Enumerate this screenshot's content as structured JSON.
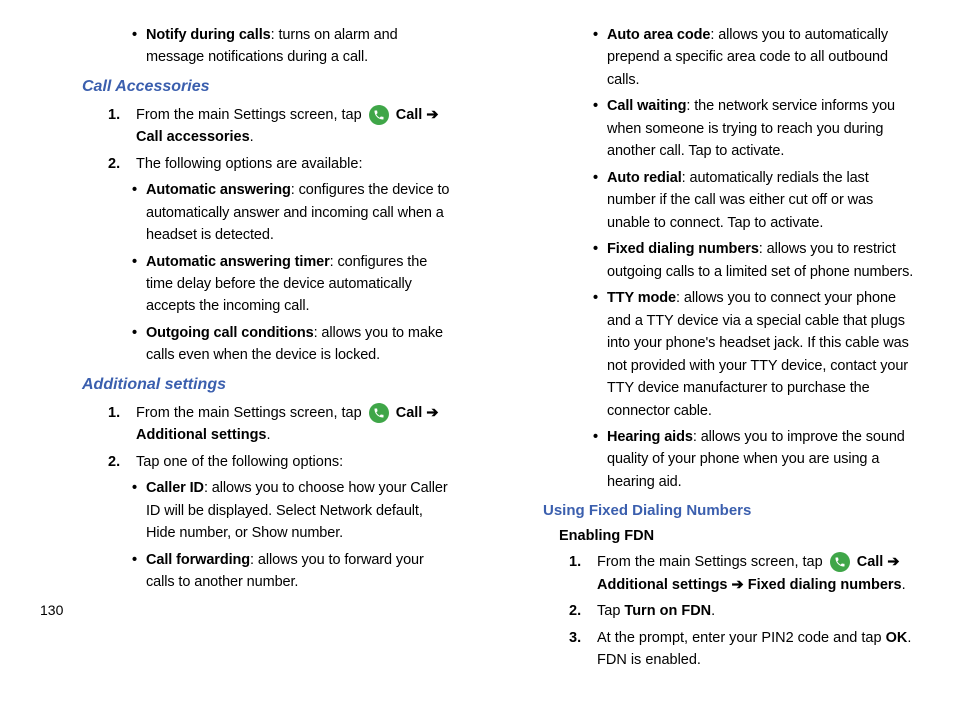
{
  "pagenum": "130",
  "left": {
    "notify_b": "Notify during calls",
    "notify_t": ": turns on alarm and message notifications during a call.",
    "h1": "Call Accessories",
    "l1_1a": "From the main Settings screen, tap ",
    "l1_1b": "Call ",
    "l1_1c": "Call accessories",
    "l1_2": "The following options are available:",
    "ca_b1_b": "Automatic answering",
    "ca_b1_t": ": configures the device to automatically answer and incoming call when a headset is detected.",
    "ca_b2_b": "Automatic answering timer",
    "ca_b2_t": ": configures the time delay before the device automatically accepts the incoming call.",
    "ca_b3_b": "Outgoing call conditions",
    "ca_b3_t": ": allows you to make calls even when the device is locked.",
    "h2": "Additional settings",
    "l2_1a": "From the main Settings screen, tap ",
    "l2_1b": "Call ",
    "l2_1c": "Additional settings",
    "l2_2": "Tap one of the following options:",
    "as_b1_b": "Caller ID",
    "as_b1_t": ": allows you to choose how your Caller ID will be displayed. Select Network default, Hide number, or Show number.",
    "as_b2_b": "Call forwarding",
    "as_b2_t": ": allows you to forward your calls to another number."
  },
  "right": {
    "r_b1_b": "Auto area code",
    "r_b1_t": ": allows you to automatically prepend a specific area code to all outbound calls.",
    "r_b2_b": "Call waiting",
    "r_b2_t": ": the network service informs you when someone is trying to reach you during another call. Tap to activate.",
    "r_b3_b": "Auto redial",
    "r_b3_t": ": automatically redials the last number if the call was either cut off or was unable to connect. Tap to activate.",
    "r_b4_b": "Fixed dialing numbers",
    "r_b4_t": ": allows you to restrict outgoing calls to a limited set of phone numbers.",
    "r_b5_b": "TTY mode",
    "r_b5_t": ": allows you to connect your phone and a TTY device via a special cable that plugs into your phone's headset jack. If this cable was not provided with your TTY device, contact your TTY device manufacturer to purchase the connector cable.",
    "r_b6_b": "Hearing aids",
    "r_b6_t": ": allows you to improve the sound quality of your phone when you are using a hearing aid.",
    "sub1": "Using Fixed Dialing Numbers",
    "sub2": "Enabling FDN",
    "f1a": "From the main Settings screen, tap ",
    "f1b": "Call ",
    "f1c": "Additional settings ",
    "f1d": " Fixed dialing numbers",
    "f2a": "Tap ",
    "f2b": "Turn on FDN",
    "f3a": "At the prompt, enter your PIN2 code and tap ",
    "f3b": "OK",
    "f3c": "FDN is enabled."
  },
  "arrow": "➔"
}
